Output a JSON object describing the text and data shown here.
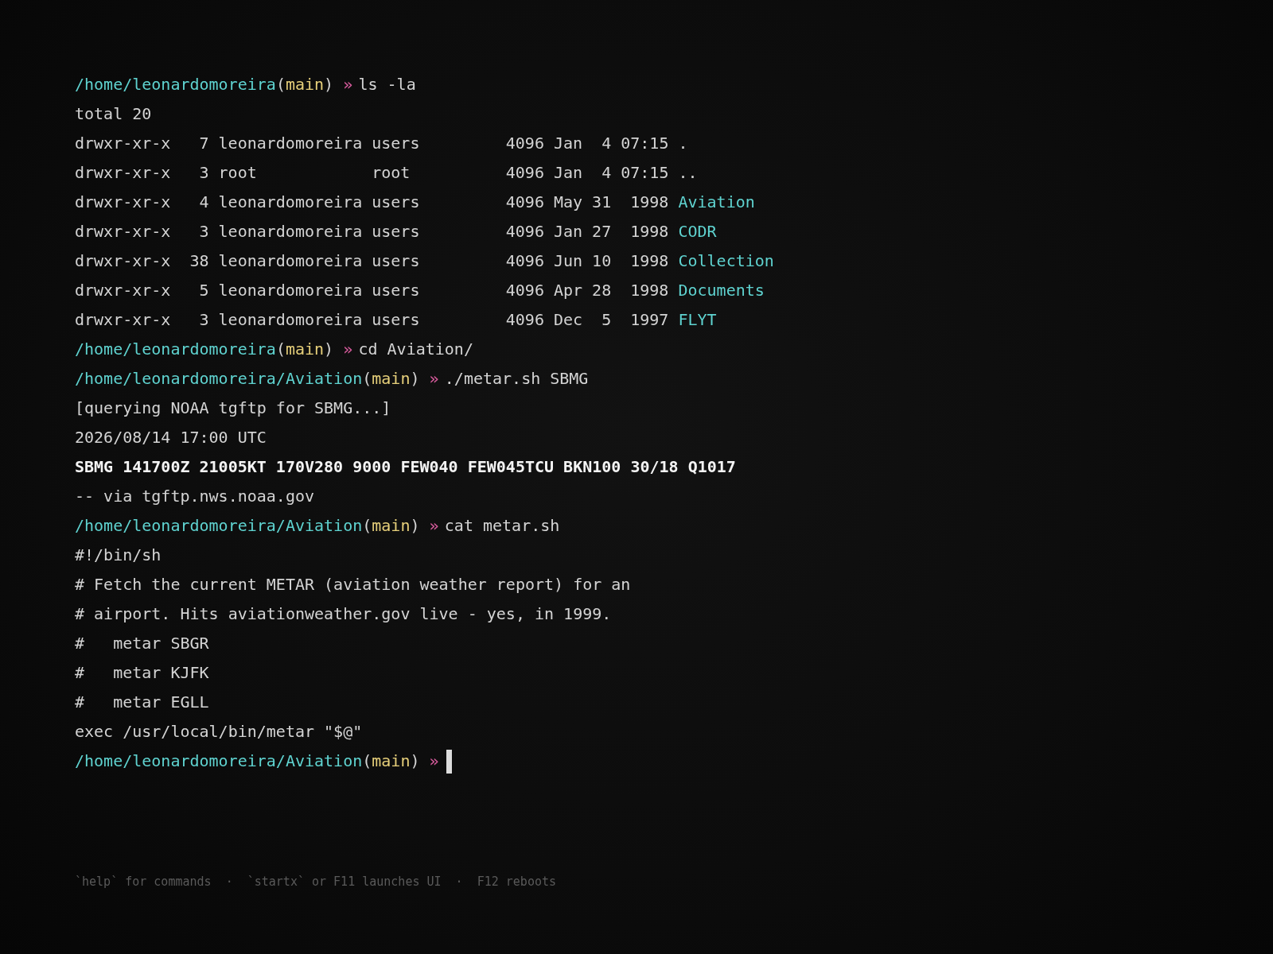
{
  "lines": [
    {
      "kind": "prompt",
      "path": "/home/leonardomoreira",
      "branch_open": "(",
      "branch": "main",
      "branch_close": ")",
      "arrow": "»",
      "command": "ls -la",
      "cursor": false
    },
    {
      "kind": "output",
      "text": "total 20"
    },
    {
      "kind": "listing",
      "perms": "drwxr-xr-x",
      "links": "7",
      "owner": "leonardomoreira",
      "group": "users",
      "size": "4096",
      "month": "Jan",
      "day": "4",
      "time": "07:15",
      "name": ".",
      "colored": false
    },
    {
      "kind": "listing",
      "perms": "drwxr-xr-x",
      "links": "3",
      "owner": "root",
      "group": "root",
      "size": "4096",
      "month": "Jan",
      "day": "4",
      "time": "07:15",
      "name": "..",
      "colored": false
    },
    {
      "kind": "listing",
      "perms": "drwxr-xr-x",
      "links": "4",
      "owner": "leonardomoreira",
      "group": "users",
      "size": "4096",
      "month": "May",
      "day": "31",
      "time": "1998",
      "name": "Aviation",
      "colored": true
    },
    {
      "kind": "listing",
      "perms": "drwxr-xr-x",
      "links": "3",
      "owner": "leonardomoreira",
      "group": "users",
      "size": "4096",
      "month": "Jan",
      "day": "27",
      "time": "1998",
      "name": "CODR",
      "colored": true
    },
    {
      "kind": "listing",
      "perms": "drwxr-xr-x",
      "links": "38",
      "owner": "leonardomoreira",
      "group": "users",
      "size": "4096",
      "month": "Jun",
      "day": "10",
      "time": "1998",
      "name": "Collection",
      "colored": true
    },
    {
      "kind": "listing",
      "perms": "drwxr-xr-x",
      "links": "5",
      "owner": "leonardomoreira",
      "group": "users",
      "size": "4096",
      "month": "Apr",
      "day": "28",
      "time": "1998",
      "name": "Documents",
      "colored": true
    },
    {
      "kind": "listing",
      "perms": "drwxr-xr-x",
      "links": "3",
      "owner": "leonardomoreira",
      "group": "users",
      "size": "4096",
      "month": "Dec",
      "day": "5",
      "time": "1997",
      "name": "FLYT",
      "colored": true
    },
    {
      "kind": "prompt",
      "path": "/home/leonardomoreira",
      "branch_open": "(",
      "branch": "main",
      "branch_close": ")",
      "arrow": "»",
      "command": "cd Aviation/",
      "cursor": false
    },
    {
      "kind": "prompt",
      "path": "/home/leonardomoreira/Aviation",
      "branch_open": "(",
      "branch": "main",
      "branch_close": ")",
      "arrow": "»",
      "command": "./metar.sh SBMG",
      "cursor": false
    },
    {
      "kind": "output",
      "text": "[querying NOAA tgftp for SBMG...]"
    },
    {
      "kind": "output",
      "text": "2026/08/14 17:00 UTC"
    },
    {
      "kind": "report",
      "text": "SBMG 141700Z 21005KT 170V280 9000 FEW040 FEW045TCU BKN100 30/18 Q1017"
    },
    {
      "kind": "output",
      "text": "-- via tgftp.nws.noaa.gov"
    },
    {
      "kind": "prompt",
      "path": "/home/leonardomoreira/Aviation",
      "branch_open": "(",
      "branch": "main",
      "branch_close": ")",
      "arrow": "»",
      "command": "cat metar.sh",
      "cursor": false
    },
    {
      "kind": "output",
      "text": "#!/bin/sh"
    },
    {
      "kind": "output",
      "text": "# Fetch the current METAR (aviation weather report) for an"
    },
    {
      "kind": "output",
      "text": "# airport. Hits aviationweather.gov live - yes, in 1999."
    },
    {
      "kind": "output",
      "text": "#   metar SBGR"
    },
    {
      "kind": "output",
      "text": "#   metar KJFK"
    },
    {
      "kind": "output",
      "text": "#   metar EGLL"
    },
    {
      "kind": "output",
      "text": "exec /usr/local/bin/metar \"$@\""
    },
    {
      "kind": "prompt",
      "path": "/home/leonardomoreira/Aviation",
      "branch_open": "(",
      "branch": "main",
      "branch_close": ")",
      "arrow": "»",
      "cursor": true
    }
  ],
  "hints": [
    "`help` for commands",
    "·",
    "`startx` or F11 launches UI",
    "·",
    "F12 reboots"
  ]
}
